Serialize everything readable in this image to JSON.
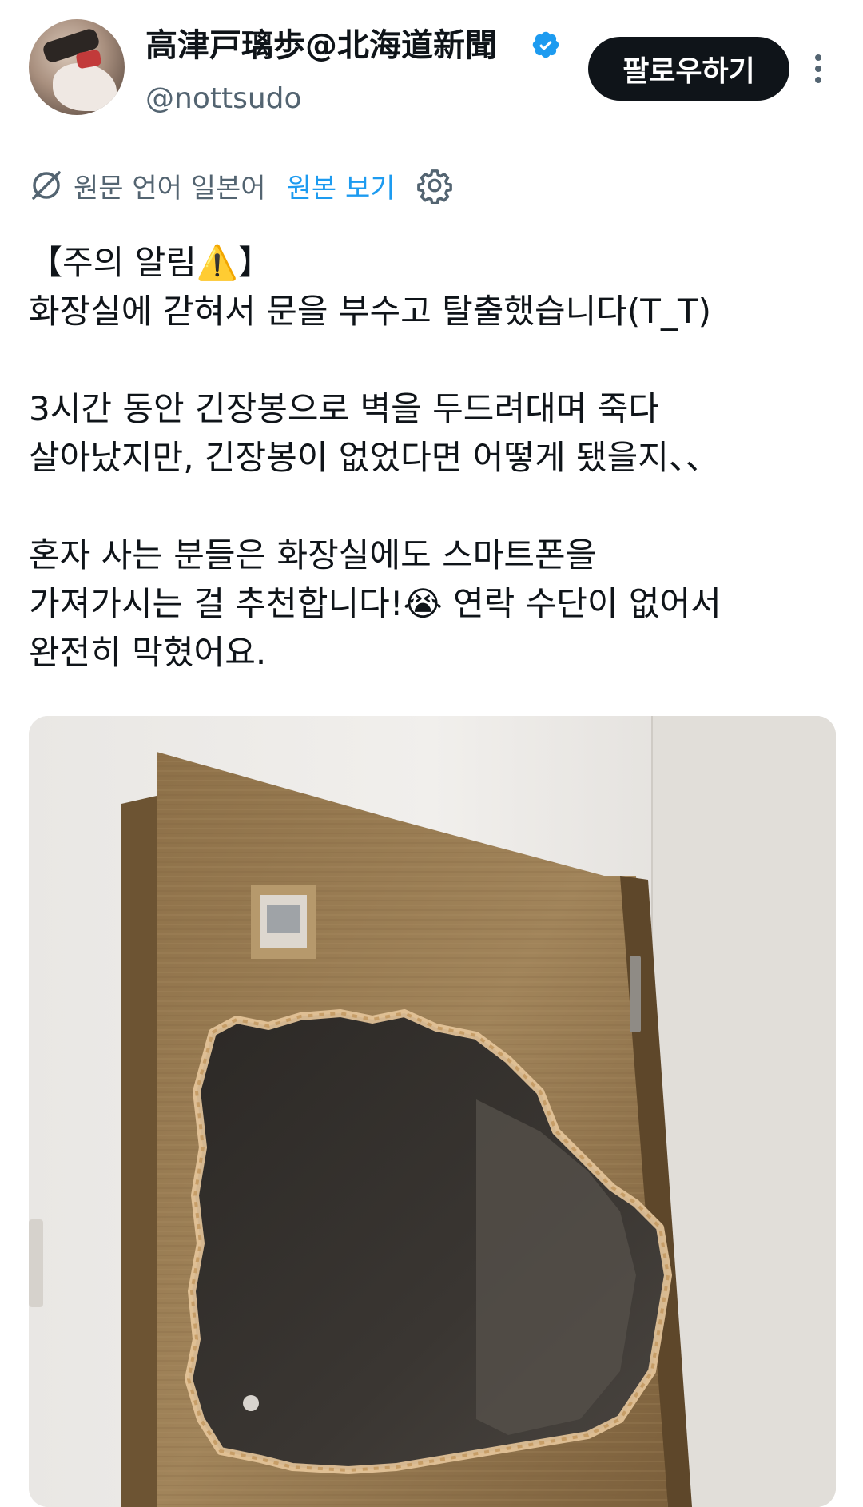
{
  "header": {
    "display_name": "高津戸璃歩@北海道新聞",
    "handle": "@nottsudo",
    "follow_label": "팔로우하기"
  },
  "translation": {
    "label": "원문 언어 일본어",
    "view_original": "원본 보기"
  },
  "tweet": {
    "lines": [
      "【주의 알림⚠️】",
      "화장실에 갇혀서 문을 부수고 탈출했습니다(T_T)",
      "",
      "3시간 동안 긴장봉으로 벽을 두드려대며 죽다",
      "살아났지만, 긴장봉이 없었다면 어떻게 됐을지、、",
      "",
      "혼자 사는 분들은 화장실에도 스마트폰을",
      "가져가시는 걸 추천합니다!😭 연락 수단이 없어서",
      "완전히 막혔어요."
    ]
  },
  "icons": {
    "verified": "verified-badge-icon",
    "more": "more-options-icon",
    "translate": "translate-icon",
    "settings": "settings-gear-icon"
  },
  "colors": {
    "accent": "#1d9bf0",
    "text": "#0f1419",
    "muted": "#536471",
    "button": "#0f1419"
  }
}
